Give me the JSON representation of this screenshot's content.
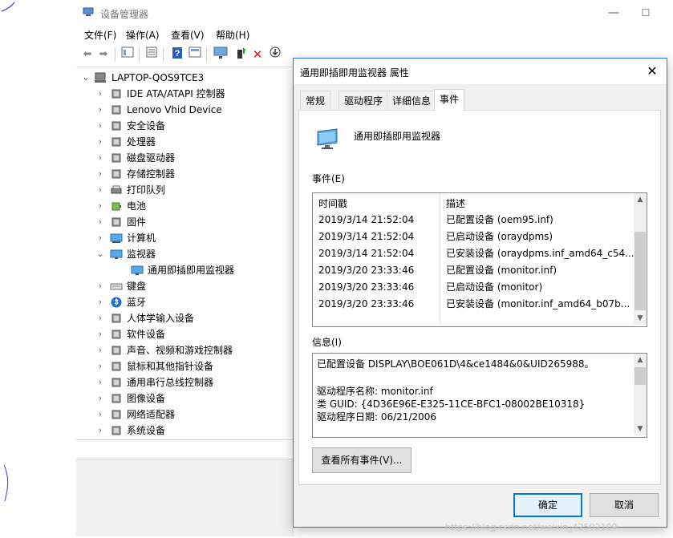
{
  "main_window": {
    "title": "设备管理器",
    "minimize_glyph": "—",
    "maximize_glyph": "☐"
  },
  "menu": [
    {
      "label": "文件(F)"
    },
    {
      "label": "操作(A)"
    },
    {
      "label": "查看(V)"
    },
    {
      "label": "帮助(H)"
    }
  ],
  "toolbar": {
    "icons": [
      "back-arrow-icon",
      "forward-arrow-icon",
      "properties-icon",
      "update-icon",
      "help-icon",
      "view-icon",
      "monitor-scan-icon",
      "enable-device-icon",
      "uninstall-x-icon",
      "download-icon"
    ]
  },
  "tree": {
    "root": "LAPTOP-QOS9TCE3",
    "items": [
      {
        "label": "IDE ATA/ATAPI 控制器",
        "icon": "ide-controller-icon",
        "expanded": false
      },
      {
        "label": "Lenovo Vhid Device",
        "icon": "hid-device-icon",
        "expanded": false
      },
      {
        "label": "安全设备",
        "icon": "security-device-icon",
        "expanded": false
      },
      {
        "label": "处理器",
        "icon": "processor-icon",
        "expanded": false
      },
      {
        "label": "磁盘驱动器",
        "icon": "disk-drive-icon",
        "expanded": false
      },
      {
        "label": "存储控制器",
        "icon": "storage-controller-icon",
        "expanded": false
      },
      {
        "label": "打印队列",
        "icon": "printer-icon",
        "expanded": false
      },
      {
        "label": "电池",
        "icon": "battery-icon",
        "expanded": false
      },
      {
        "label": "固件",
        "icon": "firmware-icon",
        "expanded": false
      },
      {
        "label": "计算机",
        "icon": "computer-icon",
        "expanded": false
      },
      {
        "label": "监视器",
        "icon": "monitor-icon",
        "expanded": true
      },
      {
        "label": "通用即插即用监视器",
        "icon": "monitor-icon",
        "child": true
      },
      {
        "label": "键盘",
        "icon": "keyboard-icon",
        "expanded": false
      },
      {
        "label": "蓝牙",
        "icon": "bluetooth-icon",
        "expanded": false
      },
      {
        "label": "人体学输入设备",
        "icon": "hid-icon",
        "expanded": false
      },
      {
        "label": "软件设备",
        "icon": "software-device-icon",
        "expanded": false
      },
      {
        "label": "声音、视频和游戏控制器",
        "icon": "sound-icon",
        "expanded": false
      },
      {
        "label": "鼠标和其他指针设备",
        "icon": "mouse-icon",
        "expanded": false
      },
      {
        "label": "通用串行总线控制器",
        "icon": "usb-icon",
        "expanded": false
      },
      {
        "label": "图像设备",
        "icon": "camera-icon",
        "expanded": false
      },
      {
        "label": "网络适配器",
        "icon": "network-adapter-icon",
        "expanded": false
      },
      {
        "label": "系统设备",
        "icon": "system-device-icon",
        "expanded": false
      }
    ]
  },
  "dialog": {
    "title": "通用即插即用监视器 属性",
    "close_glyph": "✕",
    "tabs": [
      {
        "label": "常规",
        "active": false
      },
      {
        "label": "驱动程序",
        "active": false
      },
      {
        "label": "详细信息",
        "active": false
      },
      {
        "label": "事件",
        "active": true
      }
    ],
    "device_name": "通用即插即用监视器",
    "events_label": "事件(E)",
    "events_columns": [
      "时间戳",
      "描述"
    ],
    "events": [
      {
        "time": "2019/3/14 21:52:04",
        "desc": "已配置设备 (oem95.inf)"
      },
      {
        "time": "2019/3/14 21:52:04",
        "desc": "已启动设备 (oraydpms)"
      },
      {
        "time": "2019/3/14 21:52:04",
        "desc": "已安装设备 (oraydpms.inf_amd64_c54..."
      },
      {
        "time": "2019/3/20 23:33:46",
        "desc": "已配置设备 (monitor.inf)"
      },
      {
        "time": "2019/3/20 23:33:46",
        "desc": "已启动设备 (monitor)"
      },
      {
        "time": "2019/3/20 23:33:46",
        "desc": "已安装设备 (monitor.inf_amd64_b07b..."
      }
    ],
    "info_label": "信息(I)",
    "info_lines": [
      "已配置设备 DISPLAY\\BOE061D\\4&ce1484&0&UID265988。",
      "",
      "驱动程序名称: monitor.inf",
      "类 GUID: {4D36E96E-E325-11CE-BFC1-08002BE10318}",
      "驱动程序日期: 06/21/2006"
    ],
    "view_all_button": "查看所有事件(V)...",
    "ok_button": "确定",
    "cancel_button": "取消"
  },
  "watermark": "https://blog.csdn.net/weixin_42502109",
  "colors": {
    "accent": "#0078d7",
    "dialog_border": "#2a77c9",
    "panel_bg": "#f0f0f0"
  }
}
